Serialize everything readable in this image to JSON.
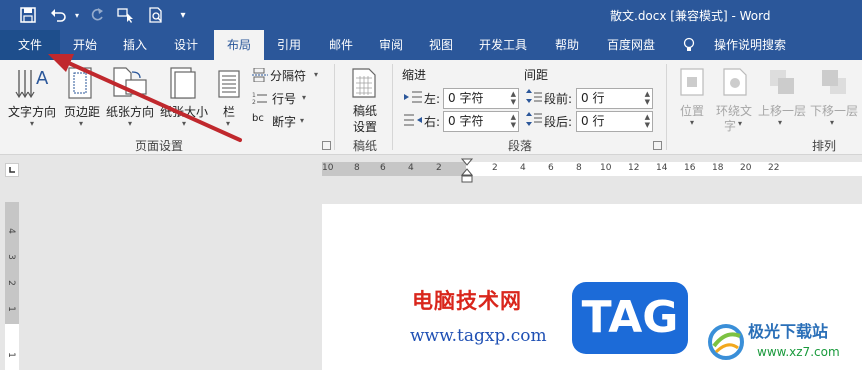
{
  "title": {
    "text": "散文.docx [兼容模式] - Word"
  },
  "tabs": {
    "file": "文件",
    "home": "开始",
    "insert": "插入",
    "design": "设计",
    "layout": "布局",
    "references": "引用",
    "mailings": "邮件",
    "review": "审阅",
    "view": "视图",
    "developer": "开发工具",
    "help": "帮助",
    "baidu": "百度网盘",
    "tellme": "操作说明搜索"
  },
  "ribbon": {
    "page_setup": {
      "text_direction": "文字方向",
      "margins": "页边距",
      "orientation": "纸张方向",
      "size": "纸张大小",
      "columns": "栏",
      "breaks": "分隔符",
      "line_numbers": "行号",
      "hyphenation": "断字",
      "label": "页面设置"
    },
    "manuscript": {
      "button": "稿纸设置",
      "button_line1": "稿纸",
      "button_line2": "设置",
      "label": "稿纸"
    },
    "paragraph": {
      "indent": "缩进",
      "spacing": "间距",
      "left": "左:",
      "right": "右:",
      "before": "段前:",
      "after": "段后:",
      "left_value": "0 字符",
      "right_value": "0 字符",
      "before_value": "0 行",
      "after_value": "0 行",
      "label": "段落"
    },
    "arrange": {
      "position": "位置",
      "wrap_line1": "环绕文",
      "wrap_line2": "字",
      "forward": "上移一层",
      "backward": "下移一层",
      "label": "排列"
    }
  },
  "ruler": {
    "h_left": [
      "10",
      "8",
      "6",
      "4",
      "2"
    ],
    "h_right": [
      "2",
      "4",
      "6",
      "8",
      "10",
      "12",
      "14",
      "16",
      "18",
      "20",
      "22"
    ],
    "v": [
      "4",
      "3",
      "2",
      "1",
      "1"
    ]
  },
  "watermark": {
    "cn": "电脑技术网",
    "url": "www.tagxp.com",
    "tag": "TAG",
    "site": "极光下载站",
    "site_url": "www.xz7.com"
  },
  "colors": {
    "title_bar": "#2b579a",
    "ribbon": "#f3f3f3",
    "arrow": "#c0282d"
  }
}
